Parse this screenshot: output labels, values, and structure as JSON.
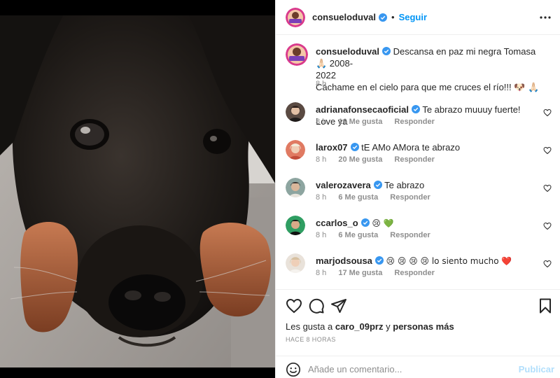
{
  "header": {
    "username": "consueloduval",
    "follow_label": "Seguir",
    "separator": "•"
  },
  "caption": {
    "username": "consueloduval",
    "text": "Descansa en paz mi negra Tomasa🙏🏻 2008-2022 Cáchame en el cielo para que me cruces el río!!! 🐶🙏🏻",
    "line1": "Descansa en paz mi negra Tomasa🙏🏻 2008-",
    "line2": "2022",
    "line3": "Cáchame en el cielo para que me cruces el río!!! 🐶 🙏🏻",
    "time": "8 h"
  },
  "comments": [
    {
      "username": "adrianafonsecaoficial",
      "text": "Te abrazo muuuy fuerte! Love ya",
      "time": "8 h",
      "likes": "16 Me gusta",
      "reply": "Responder"
    },
    {
      "username": "larox07",
      "text": "tE AMo AMora te abrazo",
      "time": "8 h",
      "likes": "20 Me gusta",
      "reply": "Responder"
    },
    {
      "username": "valerozavera",
      "text": "Te abrazo",
      "time": "8 h",
      "likes": "6 Me gusta",
      "reply": "Responder"
    },
    {
      "username": "ccarlos_o",
      "text": "😢 💚",
      "time": "8 h",
      "likes": "6 Me gusta",
      "reply": "Responder"
    },
    {
      "username": "marjodsousa",
      "text": "😢 😢 😢 😢 lo siento mucho ❤️",
      "time": "8 h",
      "likes": "17 Me gusta",
      "reply": "Responder"
    }
  ],
  "likes_line": {
    "prefix": "Les gusta a",
    "user": "caro_09prz",
    "conj": "y",
    "others": "personas más"
  },
  "time_ago": "HACE 8 HORAS",
  "add_comment": {
    "placeholder": "Añade un comentario...",
    "post_label": "Publicar"
  },
  "icons": {
    "more": "more-horizontal-icon",
    "like": "heart-icon",
    "comment": "comment-icon",
    "share": "send-icon",
    "save": "bookmark-icon",
    "emoji": "emoji-icon",
    "verified": "verified-badge-icon"
  },
  "colors": {
    "accent": "#0095f6",
    "verified": "#3897f0",
    "muted": "#8e8e8e",
    "post_disabled": "#b2dffc"
  }
}
